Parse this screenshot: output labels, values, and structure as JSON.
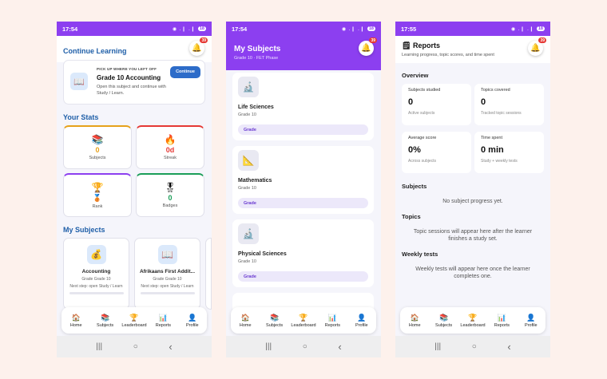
{
  "phone1": {
    "time": "17:54",
    "signal": "◉ .❙ .❙",
    "battery": "18",
    "bell_count": "39",
    "continue_title": "Continue Learning",
    "continue_kicker": "PICK UP WHERE YOU LEFT OFF",
    "continue_subject": "Grade 10 Accounting",
    "continue_desc": "Open this subject and continue with Study / Learn.",
    "continue_button": "Continue",
    "stats_title": "Your Stats",
    "stats": [
      {
        "icon": "📚",
        "value": "0",
        "label": "Subjects",
        "color": "#e6a11a"
      },
      {
        "icon": "🔥",
        "value": "0d",
        "label": "Streak",
        "color": "#e53935"
      },
      {
        "icon": "🏆",
        "value": "🥉",
        "label": "Rank",
        "color": "#8c3ff0"
      },
      {
        "icon": "🎖",
        "value": "0",
        "label": "Badges",
        "color": "#1a9e58"
      }
    ],
    "subjects_title": "My Subjects",
    "subjects": [
      {
        "icon": "💰",
        "name": "Accounting",
        "grade": "Grade Grade 10",
        "next": "Next step: open Study / Learn"
      },
      {
        "icon": "📖",
        "name": "Afrikaans First Addit...",
        "grade": "Grade Grade 10",
        "next": "Next step: open Study / Learn"
      }
    ]
  },
  "phone2": {
    "time": "17:54",
    "signal": "◉ .❙ .❙",
    "battery": "18",
    "bell_count": "39",
    "title": "My Subjects",
    "subtitle": "Grade 10 · FET Phase",
    "subjects": [
      {
        "icon": "🔬",
        "name": "Life Sciences",
        "grade": "Grade 10",
        "pill": "Grade"
      },
      {
        "icon": "📐",
        "name": "Mathematics",
        "grade": "Grade 10",
        "pill": "Grade"
      },
      {
        "icon": "🔬",
        "name": "Physical Sciences",
        "grade": "Grade 10",
        "pill": "Grade"
      }
    ]
  },
  "phone3": {
    "time": "17:55",
    "signal": "◉ .❙ .❙",
    "battery": "18",
    "bell_count": "39",
    "title_icon": "🗒",
    "title": "Reports",
    "subtitle": "Learning progress, topic scores, and time spent",
    "overview_title": "Overview",
    "overview": [
      {
        "title": "Subjects studied",
        "value": "0",
        "sub": "Active subjects"
      },
      {
        "title": "Topics covered",
        "value": "0",
        "sub": "Tracked topic sessions"
      },
      {
        "title": "Average score",
        "value": "0%",
        "sub": "Across subjects"
      },
      {
        "title": "Time spent",
        "value": "0 min",
        "sub": "Study + weekly tests"
      }
    ],
    "subjects_title": "Subjects",
    "subjects_empty": "No subject progress yet.",
    "topics_title": "Topics",
    "topics_empty": "Topic sessions will appear here after the learner finishes a study set.",
    "weekly_title": "Weekly tests",
    "weekly_empty": "Weekly tests will appear here once the learner completes one."
  },
  "nav": [
    {
      "icon": "🏠",
      "label": "Home"
    },
    {
      "icon": "📚",
      "label": "Subjects"
    },
    {
      "icon": "🏆",
      "label": "Leaderboard"
    },
    {
      "icon": "📊",
      "label": "Reports"
    },
    {
      "icon": "👤",
      "label": "Profile"
    }
  ],
  "sysnav": {
    "recents": "|||",
    "home": "○",
    "back": "‹"
  },
  "colors": {
    "accent": "#8c3ff0",
    "heading_blue": "#1f5fa8",
    "button_blue": "#2d6cc9",
    "badge_red": "#e53935"
  }
}
